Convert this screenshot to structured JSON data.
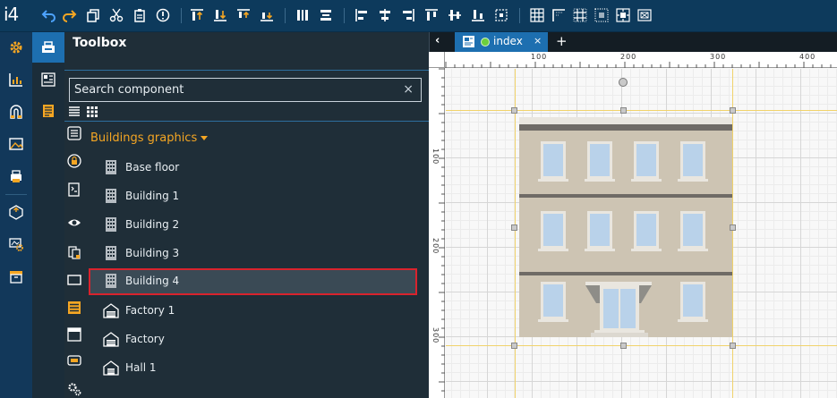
{
  "app": {
    "logo": "i4"
  },
  "toolbar": {
    "icons": [
      "undo-icon",
      "redo-icon",
      "copy-icon",
      "cut-icon",
      "paste-icon",
      "info-icon",
      "align-top-icon",
      "align-bottom-icon",
      "align-top-edge-icon",
      "align-bottom-edge-icon",
      "distribute-vertical-icon",
      "distribute-horizontal-icon",
      "align-left-icon",
      "align-center-icon",
      "align-right-icon",
      "align-top-bar-icon",
      "align-middle-icon",
      "align-bottom-bar-icon",
      "center-icon",
      "grid-icon",
      "corner-icon",
      "grid-lines-icon",
      "grid-dots-icon",
      "snap-icon",
      "fit-icon"
    ]
  },
  "toolbox": {
    "title": "Toolbox",
    "search": {
      "placeholder": "Search component",
      "value": "",
      "clear": "×"
    },
    "group": {
      "title": "Buildings graphics"
    },
    "items": [
      {
        "label": "Base floor",
        "icon": "building-icon"
      },
      {
        "label": "Building 1",
        "icon": "building-icon"
      },
      {
        "label": "Building 2",
        "icon": "building-icon"
      },
      {
        "label": "Building 3",
        "icon": "building-icon"
      },
      {
        "label": "Building 4",
        "icon": "building-icon",
        "selected": true
      },
      {
        "label": "Factory 1",
        "icon": "factory-icon"
      },
      {
        "label": "Factory",
        "icon": "factory-icon"
      },
      {
        "label": "Hall 1",
        "icon": "hall-icon"
      }
    ]
  },
  "tabs": {
    "back": "‹",
    "items": [
      {
        "label": "index",
        "close": "×",
        "status_color": "#6ccf3d"
      }
    ],
    "add": "+"
  },
  "rulers": {
    "horizontal": [
      "100",
      "200",
      "300",
      "400"
    ],
    "vertical": [
      "100",
      "200",
      "300"
    ]
  },
  "colors": {
    "accent": "#1d6fb0",
    "header": "#0d3a5c",
    "selection": "#d9232d",
    "group": "#f5a623"
  }
}
